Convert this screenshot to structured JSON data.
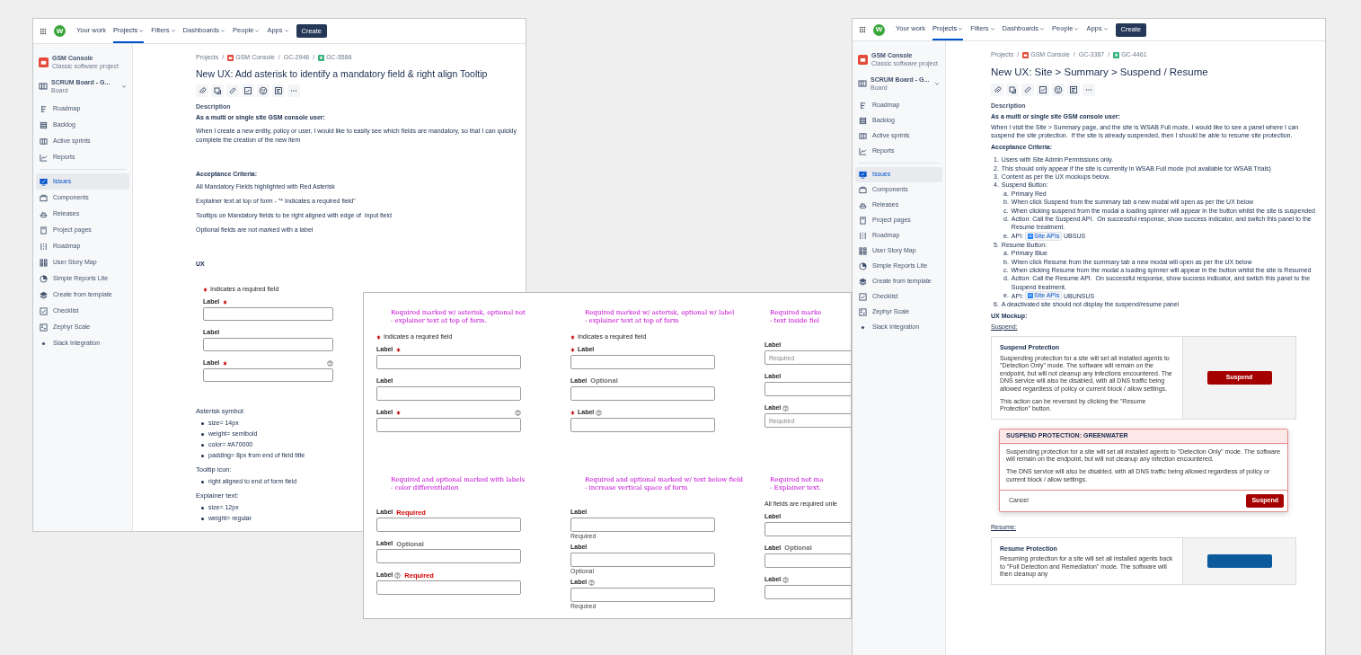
{
  "left_issue": {
    "nav": {
      "logo": "W",
      "items": [
        {
          "label": "Your work",
          "has_menu": false,
          "selected": false
        },
        {
          "label": "Projects",
          "has_menu": true,
          "selected": true
        },
        {
          "label": "Filters",
          "has_menu": true,
          "selected": false
        },
        {
          "label": "Dashboards",
          "has_menu": true,
          "selected": false
        },
        {
          "label": "People",
          "has_menu": true,
          "selected": false
        },
        {
          "label": "Apps",
          "has_menu": true,
          "selected": false
        }
      ],
      "create": "Create"
    },
    "sidebar": {
      "project": {
        "name": "GSM Console",
        "subtitle": "Classic software project"
      },
      "board": {
        "name": "SCRUM Board - G...",
        "subtitle": "Board"
      },
      "sections": [
        {
          "items": [
            {
              "kind": "roadmap",
              "label": "Roadmap",
              "selected": false
            },
            {
              "kind": "backlog",
              "label": "Backlog",
              "selected": false
            },
            {
              "kind": "sprints",
              "label": "Active sprints",
              "selected": false
            },
            {
              "kind": "reports",
              "label": "Reports",
              "selected": false
            }
          ]
        },
        {
          "items": [
            {
              "kind": "issues",
              "label": "Issues",
              "selected": true
            },
            {
              "kind": "components",
              "label": "Components",
              "selected": false
            },
            {
              "kind": "releases",
              "label": "Releases",
              "selected": false
            },
            {
              "kind": "pages",
              "label": "Project pages",
              "selected": false
            },
            {
              "kind": "timeline",
              "label": "Roadmap",
              "selected": false
            },
            {
              "kind": "storymap",
              "label": "User Story Map",
              "selected": false
            },
            {
              "kind": "piechart",
              "label": "Simple Reports Lite",
              "selected": false
            },
            {
              "kind": "template",
              "label": "Create from template",
              "selected": false
            },
            {
              "kind": "checklist",
              "label": "Checklist",
              "selected": false
            },
            {
              "kind": "zephyr",
              "label": "Zephyr Scale",
              "selected": false
            },
            {
              "kind": "dot",
              "label": "Slack Integration",
              "selected": false
            }
          ]
        }
      ]
    },
    "breadcrumbs": [
      {
        "kind": "plain",
        "text": "Projects"
      },
      {
        "kind": "project",
        "separator": "/",
        "text": "GSM Console"
      },
      {
        "kind": "plain",
        "separator": "/",
        "text": "GC-2946"
      },
      {
        "kind": "story",
        "separator": "/",
        "text": "GC-5586"
      }
    ],
    "title": "New UX: Add asterisk to identify a mandatory field & right align Tooltip",
    "blocks": [
      {
        "kind": "heading",
        "text": "Description"
      },
      {
        "kind": "bold",
        "text": "As a multi or single site GSM console user:"
      },
      {
        "kind": "para",
        "text": "When I create a new entity, policy or user, I would like to easily see which fields are mandatory, so that I can quickly complete the creation of the new item"
      },
      {
        "kind": "section",
        "text": "Acceptance Criteria:"
      },
      {
        "kind": "para",
        "text": "All Mandatory Fields highlighted with Red Asterisk"
      },
      {
        "kind": "para",
        "text": "Explainer text at top of form - \"* Indicates a required field\""
      },
      {
        "kind": "para",
        "text": "Tooltips on Mandatory fields to be right aligned with edge of  input field"
      },
      {
        "kind": "para",
        "text": "Optional fields are not marked with a label"
      },
      {
        "kind": "section",
        "text": "UX"
      },
      {
        "kind": "form",
        "explainer": {
          "text": "Indicates a required field",
          "asterisk": true
        },
        "fields": [
          {
            "label": "Label",
            "required": true,
            "tooltip": false
          },
          {
            "label": "Label",
            "required": false,
            "tooltip": false
          },
          {
            "label": "Label",
            "required": true,
            "tooltip": true
          }
        ]
      },
      {
        "kind": "label",
        "text": "Asterisk symbol:"
      },
      {
        "kind": "bullets",
        "items": [
          "size= 14px",
          "weight= semibold",
          "color= #A70000",
          "padding= 8px from end of field title"
        ]
      },
      {
        "kind": "label",
        "text": "Tooltip icon:"
      },
      {
        "kind": "bullets",
        "items": [
          "right aligned to end of form field"
        ]
      },
      {
        "kind": "label",
        "text": "Explainer text:"
      },
      {
        "kind": "bullets",
        "items": [
          "size= 12px",
          "weight= regular"
        ]
      }
    ]
  },
  "form_mockups": {
    "variants": [
      {
        "kind": "suffix",
        "note": [
          "Required marked w/ asterisk, optional not",
          "- explainer text at top of form."
        ],
        "explainer": {
          "text": "Indicates a required field",
          "asterisk": true
        },
        "fields": [
          {
            "label": "Label",
            "required": true,
            "tooltip": false
          },
          {
            "label": "Label",
            "required": false,
            "tooltip": false
          },
          {
            "label": "Label",
            "required": true,
            "tooltip": true
          }
        ]
      },
      {
        "kind": "prefix",
        "note": [
          "Required marked w/ asterisk, optional w/ label",
          "- explainer text at top of form"
        ],
        "explainer": {
          "text": "Indicates a required field",
          "asterisk": true
        },
        "fields": [
          {
            "label": "Label",
            "required": true,
            "tooltip": false
          },
          {
            "label": "Label",
            "required": false,
            "tooltip": false,
            "tag": {
              "text": "Optional",
              "color": "#6b6b6b"
            }
          },
          {
            "label": "Label",
            "required": true,
            "tooltip": true
          }
        ]
      },
      {
        "kind": "placeholder",
        "note": [
          "Required marke",
          "- text inside fiel"
        ],
        "fields": [
          {
            "label": "Label",
            "tooltip": false,
            "placeholder": "Required"
          },
          {
            "label": "Label",
            "tooltip": false
          },
          {
            "label": "Label",
            "tooltip": true,
            "placeholder": "Required"
          }
        ]
      },
      {
        "kind": "tags",
        "note": [
          "Required and optional marked with labels",
          "- color differentiation"
        ],
        "fields": [
          {
            "label": "Label",
            "tooltip": false,
            "tag": {
              "text": "Required",
              "color": "#d40000"
            }
          },
          {
            "label": "Label",
            "tooltip": false,
            "tag": {
              "text": "Optional",
              "color": "#6b6b6b"
            }
          },
          {
            "label": "Label",
            "tooltip": true,
            "tag": {
              "text": "Required",
              "color": "#d40000"
            }
          }
        ]
      },
      {
        "kind": "helpers",
        "note": [
          "Required and optional marked w/ text below field",
          "- increase vertical space of form"
        ],
        "fields": [
          {
            "label": "Label",
            "tooltip": false,
            "helper": "Required"
          },
          {
            "label": "Label",
            "tooltip": false,
            "helper": "Optional"
          },
          {
            "label": "Label",
            "tooltip": true,
            "helper": "Required"
          }
        ]
      },
      {
        "kind": "explained",
        "note": [
          "Required not ma",
          "- Explainer text."
        ],
        "explainer": {
          "text": "All fields are required unle",
          "asterisk": false
        },
        "fields": [
          {
            "label": "Label",
            "tooltip": false
          },
          {
            "label": "Label",
            "tooltip": false,
            "tag": {
              "text": "Optional",
              "color": "#6b6b6b"
            }
          },
          {
            "label": "Label",
            "tooltip": true
          }
        ]
      }
    ]
  },
  "right_issue": {
    "nav": {
      "logo": "W",
      "items": [
        {
          "label": "Your work",
          "has_menu": false,
          "selected": false
        },
        {
          "label": "Projects",
          "has_menu": true,
          "selected": true
        },
        {
          "label": "Filters",
          "has_menu": true,
          "selected": false
        },
        {
          "label": "Dashboards",
          "has_menu": true,
          "selected": false
        },
        {
          "label": "People",
          "has_menu": true,
          "selected": false
        },
        {
          "label": "Apps",
          "has_menu": true,
          "selected": false
        }
      ],
      "create": "Create"
    },
    "sidebar": {
      "project": {
        "name": "GSM Console",
        "subtitle": "Classic software project"
      },
      "board": {
        "name": "SCRUM Board - G...",
        "subtitle": "Board"
      },
      "sections": [
        {
          "items": [
            {
              "kind": "roadmap",
              "label": "Roadmap",
              "selected": false
            },
            {
              "kind": "backlog",
              "label": "Backlog",
              "selected": false
            },
            {
              "kind": "sprints",
              "label": "Active sprints",
              "selected": false
            },
            {
              "kind": "reports",
              "label": "Reports",
              "selected": false
            }
          ]
        },
        {
          "items": [
            {
              "kind": "issues",
              "label": "Issues",
              "selected": true
            },
            {
              "kind": "components",
              "label": "Components",
              "selected": false
            },
            {
              "kind": "releases",
              "label": "Releases",
              "selected": false
            },
            {
              "kind": "pages",
              "label": "Project pages",
              "selected": false
            },
            {
              "kind": "timeline",
              "label": "Roadmap",
              "selected": false
            },
            {
              "kind": "storymap",
              "label": "User Story Map",
              "selected": false
            },
            {
              "kind": "piechart",
              "label": "Simple Reports Lite",
              "selected": false
            },
            {
              "kind": "template",
              "label": "Create from template",
              "selected": false
            },
            {
              "kind": "checklist",
              "label": "Checklist",
              "selected": false
            },
            {
              "kind": "zephyr",
              "label": "Zephyr Scale",
              "selected": false
            },
            {
              "kind": "dot",
              "label": "Slack Integration",
              "selected": false
            }
          ]
        }
      ]
    },
    "breadcrumbs": [
      {
        "kind": "plain",
        "text": "Projects"
      },
      {
        "kind": "project",
        "separator": "/",
        "text": "GSM Console"
      },
      {
        "kind": "plain",
        "separator": "/",
        "text": "GC-3387"
      },
      {
        "kind": "story",
        "separator": "/",
        "text": "GC-4461"
      }
    ],
    "title": "New UX: Site > Summary > Suspend / Resume",
    "blocks": [
      {
        "kind": "heading",
        "text": "Description"
      },
      {
        "kind": "bold",
        "text": "As a multi or single site GSM console user:"
      },
      {
        "kind": "para",
        "text": "When I visit the Site > Summary page, and the site is WSAB Full mode, I would like to see a panel where I can suspend the site protection.  If the site is already suspended, then I should be able to resume site protection."
      },
      {
        "kind": "bold",
        "text": "Acceptance Criteria:"
      },
      {
        "kind": "ordered",
        "items": [
          {
            "marker": "1.",
            "text": "Users with Site Admin Permissions only."
          },
          {
            "marker": "2.",
            "text": "This should only appear if the site is currently in WSAB Full mode (not available for WSAB Trials)"
          },
          {
            "marker": "3.",
            "text": "Content as per the UX mockups below."
          },
          {
            "marker": "4.",
            "text": "Suspend Button:",
            "children": [
              {
                "marker": "a.",
                "text": "Primary Red"
              },
              {
                "marker": "b.",
                "text": "When click Suspend from the summary tab a new modal will open as per the UX below"
              },
              {
                "marker": "c.",
                "text": "When clicking suspend from the modal a loading spinner will appear in the button whilst the site is suspended"
              },
              {
                "marker": "d.",
                "text": "Action: Call the Suspend API.  On successful response, show success indicator, and switch this panel to the Resume treatment."
              },
              {
                "marker": "e.",
                "text": "API:",
                "link": "Site APIs",
                "after": "UBSUS"
              }
            ]
          },
          {
            "marker": "5.",
            "text": "Resume Button:",
            "children": [
              {
                "marker": "a.",
                "text": "Primary Blue"
              },
              {
                "marker": "b.",
                "text": "When click Resume from the summary tab a new modal will open as per the UX below"
              },
              {
                "marker": "c.",
                "text": "When clicking Resume from the modal a loading spinner will appear in the button whilst the site is Resumed"
              },
              {
                "marker": "d.",
                "text": "Action: Call the Resume API.  On successful response, show success indicator, and switch this panel to the Suspend treatment."
              },
              {
                "marker": "e.",
                "text": "API:",
                "link": "Site APIs",
                "after": "UBUNSUS"
              }
            ]
          },
          {
            "marker": "6.",
            "text": "A deactivated site should not display the suspend/resume panel"
          }
        ]
      },
      {
        "kind": "bold",
        "text": "UX Mockup:"
      },
      {
        "kind": "underlined",
        "text": "Suspend:"
      },
      {
        "kind": "panel",
        "title": "Suspend Protection",
        "paragraphs": [
          "Suspending protection for a site will set all installed agents to \"Detection Only\" mode. The software will remain on the endpoint, but will not cleanup any infections encountered. The DNS service will also be disabled, with all DNS traffic being allowed regardless of policy or current block / allow settings.",
          "This action can be reversed by clicking the \"Resume Protection\" button."
        ],
        "button": {
          "label": "Suspend",
          "color": "#a50000"
        }
      },
      {
        "kind": "modal",
        "title": "SUSPEND PROTECTION: GREENWATER",
        "paragraphs": [
          "Suspending protection for a site will set all installed agents to \"Detection Only\" mode. The software will remain on the endpoint, but will not cleanup any infection encountered.",
          "The DNS service will also be disabled, with all DNS traffic being allowed regardless of policy or current block / allow settings."
        ],
        "buttons": [
          {
            "kind": "plain",
            "label": "Cancel"
          },
          {
            "kind": "primary",
            "label": "Suspend"
          }
        ]
      },
      {
        "kind": "underlined",
        "text": "Resume:"
      },
      {
        "kind": "panel",
        "title": "Resume Protection",
        "paragraphs": [
          "Resuming protection for a site will set all installed agents back to \"Full Detection and Remediation\" mode. The software will then cleanup any"
        ],
        "button": {
          "color": "#0a5a9c"
        }
      }
    ]
  }
}
